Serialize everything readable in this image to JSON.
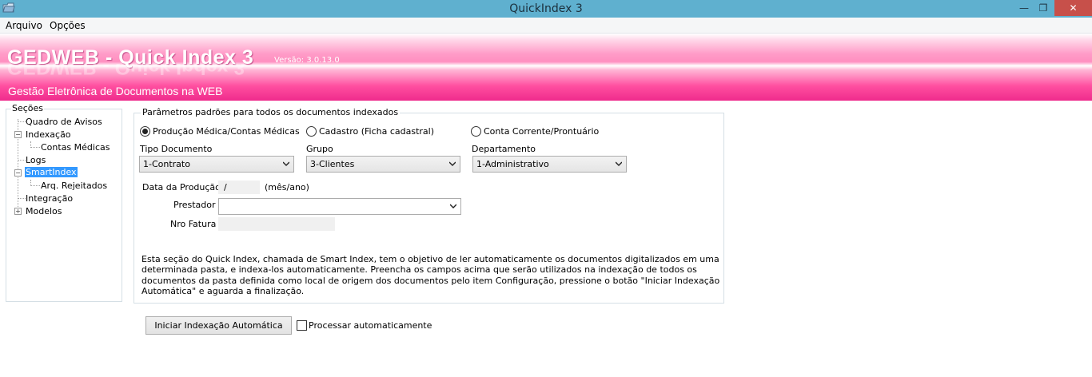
{
  "window": {
    "title": "QuickIndex 3",
    "controls": {
      "minimize": "—",
      "maximize": "❐",
      "close": "✕"
    }
  },
  "menu": {
    "items": [
      "Arquivo",
      "Opções"
    ]
  },
  "banner": {
    "title": "GEDWEB - Quick Index 3",
    "version": "Versão:  3.0.13.0",
    "subtitle": "Gestão Eletrônica de Documentos na WEB"
  },
  "sections": {
    "legend": "Seções",
    "items": [
      "Quadro de Avisos",
      "Indexação",
      "Contas Médicas",
      "Logs",
      "SmartIndex",
      "Arq. Rejeitados",
      "Integração",
      "Modelos"
    ],
    "selected": "SmartIndex"
  },
  "params": {
    "legend": "Parâmetros padrões para todos os documentos indexados",
    "radios": [
      {
        "label": "Produção Médica/Contas Médicas",
        "checked": true
      },
      {
        "label": "Cadastro (Ficha cadastral)",
        "checked": false
      },
      {
        "label": "Conta Corrente/Prontuário",
        "checked": false
      }
    ],
    "tipo_documento": {
      "label": "Tipo Documento",
      "value": "1-Contrato"
    },
    "grupo": {
      "label": "Grupo",
      "value": "3-Clientes"
    },
    "departamento": {
      "label": "Departamento",
      "value": "1-Administrativo"
    },
    "data_producao": {
      "label": "Data da Produção",
      "value": "/",
      "hint": "(mês/ano)"
    },
    "prestador": {
      "label": "Prestador",
      "value": ""
    },
    "nro_fatura": {
      "label": "Nro Fatura",
      "value": ""
    },
    "description": "Esta seção do Quick Index, chamada de Smart Index, tem o objetivo de ler automaticamente os documentos digitalizados em uma determinada pasta, e indexa-los automaticamente. Preencha os campos acima que serão utilizados na indexação de todos os documentos da pasta definida como local de origem dos documentos pelo item Configuração, pressione o botão \"Iniciar Indexação Automática\" e aguarda a finalização."
  },
  "actions": {
    "start_button": "Iniciar Indexação Automática",
    "auto_checkbox": {
      "label": "Processar automaticamente",
      "checked": false
    }
  }
}
